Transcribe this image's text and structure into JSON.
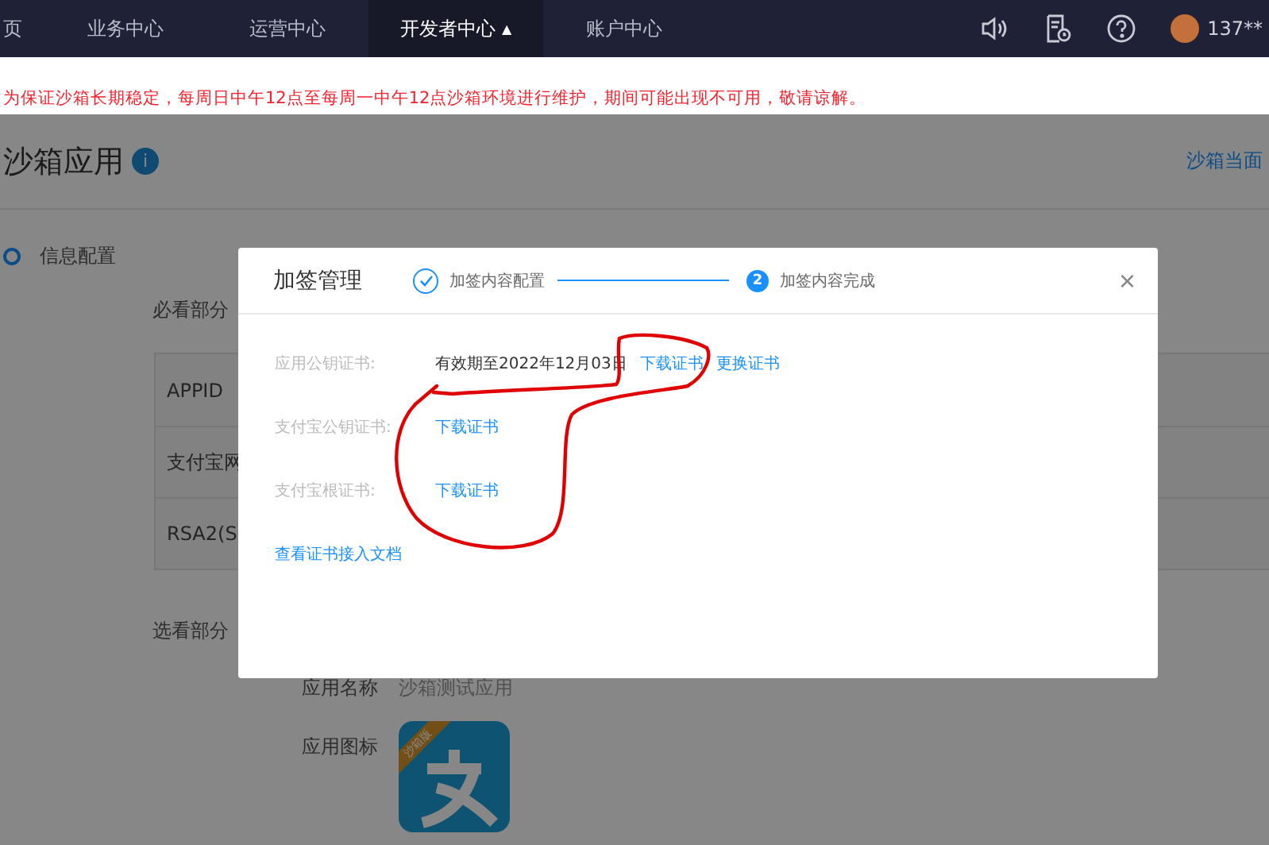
{
  "nav": {
    "items": [
      {
        "label": "页",
        "selected": false
      },
      {
        "label": "业务中心",
        "selected": false
      },
      {
        "label": "运营中心",
        "selected": false
      },
      {
        "label": "开发者中心",
        "selected": true,
        "caret": "▲"
      },
      {
        "label": "账户中心",
        "selected": false
      }
    ],
    "user": "137**"
  },
  "notice": "为保证沙箱长期稳定，每周日中午12点至每周一中午12点沙箱环境进行维护，期间可能出现不可用，敬请谅解。",
  "page": {
    "title": "沙箱应用",
    "info_icon": "i",
    "side_link": "沙箱当面",
    "section": "信息配置",
    "required_label": "必看部分",
    "required_rows": [
      "APPID",
      "支付宝网",
      "RSA2(S"
    ],
    "optional_label": "选看部分",
    "fields": [
      {
        "kind": "text",
        "label": "应用名称",
        "value": "沙箱测试应用"
      },
      {
        "kind": "icon",
        "label": "应用图标",
        "badge": "沙箱版"
      }
    ]
  },
  "dialog": {
    "title": "加签管理",
    "steps": [
      {
        "label": "加签内容配置",
        "done": true
      },
      {
        "label": "加签内容完成",
        "number": "2",
        "done": false
      }
    ],
    "close": "×",
    "rows": [
      {
        "label": "应用公钥证书:",
        "text": "有效期至2022年12月03日",
        "links": [
          "下载证书",
          "更换证书"
        ]
      },
      {
        "label": "支付宝公钥证书:",
        "links": [
          "下载证书"
        ]
      },
      {
        "label": "支付宝根证书:",
        "links": [
          "下载证书"
        ]
      }
    ],
    "doc_link": "查看证书接入文档"
  }
}
